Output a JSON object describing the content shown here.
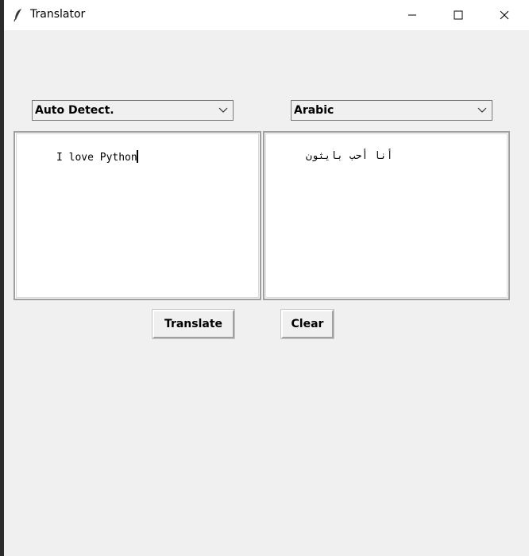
{
  "window": {
    "title": "Translator",
    "app_icon": "feather-icon",
    "controls": {
      "minimize_icon": "minimize-icon",
      "maximize_icon": "maximize-icon",
      "close_icon": "close-icon"
    }
  },
  "source_language": {
    "selected": "Auto Detect.",
    "arrow_icon": "chevron-down-icon"
  },
  "target_language": {
    "selected": "Arabic",
    "arrow_icon": "chevron-down-icon"
  },
  "input_text": "I love Python",
  "output_text": "أنا أحب بايثون",
  "buttons": {
    "translate_label": "Translate",
    "clear_label": "Clear"
  },
  "colors": {
    "window_bg": "#f0f0f0",
    "titlebar_bg": "#ffffff",
    "text_area_bg": "#ffffff"
  }
}
